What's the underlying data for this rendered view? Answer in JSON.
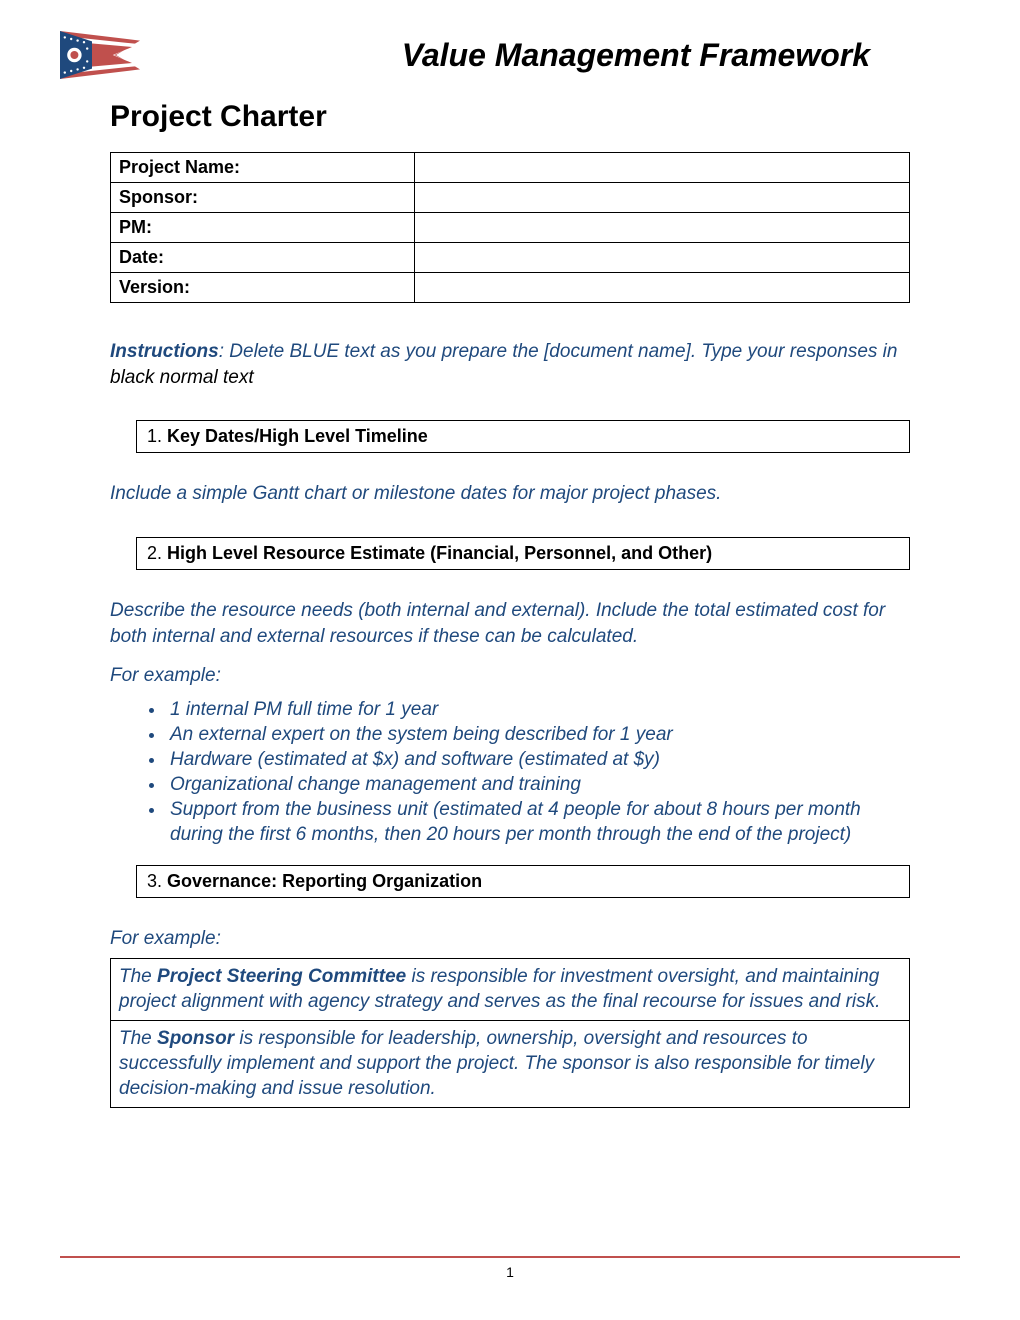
{
  "header": {
    "title": "Value Management Framework"
  },
  "docTitle": "Project Charter",
  "info": {
    "projectNameLabel": "Project Name:",
    "projectNameValue": "",
    "sponsorLabel": "Sponsor:",
    "sponsorValue": "",
    "pmLabel": "PM:",
    "pmValue": "",
    "dateLabel": "Date:",
    "dateValue": "",
    "versionLabel": "Version:",
    "versionValue": ""
  },
  "instructions": {
    "bold": "Instructions",
    "part1": ": Delete BLUE text as you prepare the [document name]. Type your responses in ",
    "black": "black normal text"
  },
  "section1": {
    "num": "1.",
    "title": "Key Dates/High Level Timeline",
    "note": "Include a simple Gantt chart or milestone dates for major project phases."
  },
  "section2": {
    "num": "2.",
    "title": "High Level Resource Estimate (Financial, Personnel, and Other)",
    "note": "Describe the resource needs (both internal and external). Include the total estimated cost for both internal and external resources if these can be calculated.",
    "forExample": "For example:",
    "bullets": [
      "1 internal PM full time for 1 year",
      "An external expert on the system being described for 1 year",
      "Hardware (estimated at $x) and software (estimated at $y)",
      "Organizational change management and training",
      "Support from the business unit (estimated at 4 people for about 8 hours per month during the first 6 months, then 20 hours per month through the end of the project)"
    ]
  },
  "section3": {
    "num": "3.",
    "title": "Governance: Reporting Organization",
    "forExample": "For example:",
    "rows": [
      {
        "pre": "The ",
        "role": "Project Steering Committee",
        "post": " is responsible for investment oversight, and maintaining project alignment with agency strategy and serves as the final recourse for issues and risk."
      },
      {
        "pre": "The ",
        "role": "Sponsor",
        "post": " is responsible for leadership, ownership, oversight and resources to successfully implement and support the project. The sponsor is also responsible for timely decision-making and issue resolution."
      }
    ]
  },
  "footer": {
    "pageNumber": "1"
  }
}
